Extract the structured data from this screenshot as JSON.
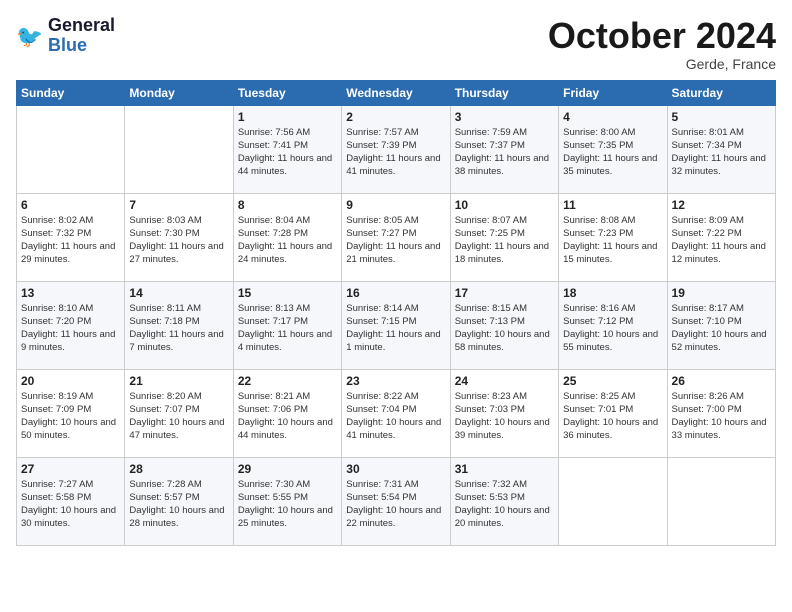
{
  "header": {
    "logo_line1": "General",
    "logo_line2": "Blue",
    "month": "October 2024",
    "location": "Gerde, France"
  },
  "days_of_week": [
    "Sunday",
    "Monday",
    "Tuesday",
    "Wednesday",
    "Thursday",
    "Friday",
    "Saturday"
  ],
  "weeks": [
    [
      {
        "day": "",
        "sunrise": "",
        "sunset": "",
        "daylight": ""
      },
      {
        "day": "",
        "sunrise": "",
        "sunset": "",
        "daylight": ""
      },
      {
        "day": "1",
        "sunrise": "Sunrise: 7:56 AM",
        "sunset": "Sunset: 7:41 PM",
        "daylight": "Daylight: 11 hours and 44 minutes."
      },
      {
        "day": "2",
        "sunrise": "Sunrise: 7:57 AM",
        "sunset": "Sunset: 7:39 PM",
        "daylight": "Daylight: 11 hours and 41 minutes."
      },
      {
        "day": "3",
        "sunrise": "Sunrise: 7:59 AM",
        "sunset": "Sunset: 7:37 PM",
        "daylight": "Daylight: 11 hours and 38 minutes."
      },
      {
        "day": "4",
        "sunrise": "Sunrise: 8:00 AM",
        "sunset": "Sunset: 7:35 PM",
        "daylight": "Daylight: 11 hours and 35 minutes."
      },
      {
        "day": "5",
        "sunrise": "Sunrise: 8:01 AM",
        "sunset": "Sunset: 7:34 PM",
        "daylight": "Daylight: 11 hours and 32 minutes."
      }
    ],
    [
      {
        "day": "6",
        "sunrise": "Sunrise: 8:02 AM",
        "sunset": "Sunset: 7:32 PM",
        "daylight": "Daylight: 11 hours and 29 minutes."
      },
      {
        "day": "7",
        "sunrise": "Sunrise: 8:03 AM",
        "sunset": "Sunset: 7:30 PM",
        "daylight": "Daylight: 11 hours and 27 minutes."
      },
      {
        "day": "8",
        "sunrise": "Sunrise: 8:04 AM",
        "sunset": "Sunset: 7:28 PM",
        "daylight": "Daylight: 11 hours and 24 minutes."
      },
      {
        "day": "9",
        "sunrise": "Sunrise: 8:05 AM",
        "sunset": "Sunset: 7:27 PM",
        "daylight": "Daylight: 11 hours and 21 minutes."
      },
      {
        "day": "10",
        "sunrise": "Sunrise: 8:07 AM",
        "sunset": "Sunset: 7:25 PM",
        "daylight": "Daylight: 11 hours and 18 minutes."
      },
      {
        "day": "11",
        "sunrise": "Sunrise: 8:08 AM",
        "sunset": "Sunset: 7:23 PM",
        "daylight": "Daylight: 11 hours and 15 minutes."
      },
      {
        "day": "12",
        "sunrise": "Sunrise: 8:09 AM",
        "sunset": "Sunset: 7:22 PM",
        "daylight": "Daylight: 11 hours and 12 minutes."
      }
    ],
    [
      {
        "day": "13",
        "sunrise": "Sunrise: 8:10 AM",
        "sunset": "Sunset: 7:20 PM",
        "daylight": "Daylight: 11 hours and 9 minutes."
      },
      {
        "day": "14",
        "sunrise": "Sunrise: 8:11 AM",
        "sunset": "Sunset: 7:18 PM",
        "daylight": "Daylight: 11 hours and 7 minutes."
      },
      {
        "day": "15",
        "sunrise": "Sunrise: 8:13 AM",
        "sunset": "Sunset: 7:17 PM",
        "daylight": "Daylight: 11 hours and 4 minutes."
      },
      {
        "day": "16",
        "sunrise": "Sunrise: 8:14 AM",
        "sunset": "Sunset: 7:15 PM",
        "daylight": "Daylight: 11 hours and 1 minute."
      },
      {
        "day": "17",
        "sunrise": "Sunrise: 8:15 AM",
        "sunset": "Sunset: 7:13 PM",
        "daylight": "Daylight: 10 hours and 58 minutes."
      },
      {
        "day": "18",
        "sunrise": "Sunrise: 8:16 AM",
        "sunset": "Sunset: 7:12 PM",
        "daylight": "Daylight: 10 hours and 55 minutes."
      },
      {
        "day": "19",
        "sunrise": "Sunrise: 8:17 AM",
        "sunset": "Sunset: 7:10 PM",
        "daylight": "Daylight: 10 hours and 52 minutes."
      }
    ],
    [
      {
        "day": "20",
        "sunrise": "Sunrise: 8:19 AM",
        "sunset": "Sunset: 7:09 PM",
        "daylight": "Daylight: 10 hours and 50 minutes."
      },
      {
        "day": "21",
        "sunrise": "Sunrise: 8:20 AM",
        "sunset": "Sunset: 7:07 PM",
        "daylight": "Daylight: 10 hours and 47 minutes."
      },
      {
        "day": "22",
        "sunrise": "Sunrise: 8:21 AM",
        "sunset": "Sunset: 7:06 PM",
        "daylight": "Daylight: 10 hours and 44 minutes."
      },
      {
        "day": "23",
        "sunrise": "Sunrise: 8:22 AM",
        "sunset": "Sunset: 7:04 PM",
        "daylight": "Daylight: 10 hours and 41 minutes."
      },
      {
        "day": "24",
        "sunrise": "Sunrise: 8:23 AM",
        "sunset": "Sunset: 7:03 PM",
        "daylight": "Daylight: 10 hours and 39 minutes."
      },
      {
        "day": "25",
        "sunrise": "Sunrise: 8:25 AM",
        "sunset": "Sunset: 7:01 PM",
        "daylight": "Daylight: 10 hours and 36 minutes."
      },
      {
        "day": "26",
        "sunrise": "Sunrise: 8:26 AM",
        "sunset": "Sunset: 7:00 PM",
        "daylight": "Daylight: 10 hours and 33 minutes."
      }
    ],
    [
      {
        "day": "27",
        "sunrise": "Sunrise: 7:27 AM",
        "sunset": "Sunset: 5:58 PM",
        "daylight": "Daylight: 10 hours and 30 minutes."
      },
      {
        "day": "28",
        "sunrise": "Sunrise: 7:28 AM",
        "sunset": "Sunset: 5:57 PM",
        "daylight": "Daylight: 10 hours and 28 minutes."
      },
      {
        "day": "29",
        "sunrise": "Sunrise: 7:30 AM",
        "sunset": "Sunset: 5:55 PM",
        "daylight": "Daylight: 10 hours and 25 minutes."
      },
      {
        "day": "30",
        "sunrise": "Sunrise: 7:31 AM",
        "sunset": "Sunset: 5:54 PM",
        "daylight": "Daylight: 10 hours and 22 minutes."
      },
      {
        "day": "31",
        "sunrise": "Sunrise: 7:32 AM",
        "sunset": "Sunset: 5:53 PM",
        "daylight": "Daylight: 10 hours and 20 minutes."
      },
      {
        "day": "",
        "sunrise": "",
        "sunset": "",
        "daylight": ""
      },
      {
        "day": "",
        "sunrise": "",
        "sunset": "",
        "daylight": ""
      }
    ]
  ]
}
